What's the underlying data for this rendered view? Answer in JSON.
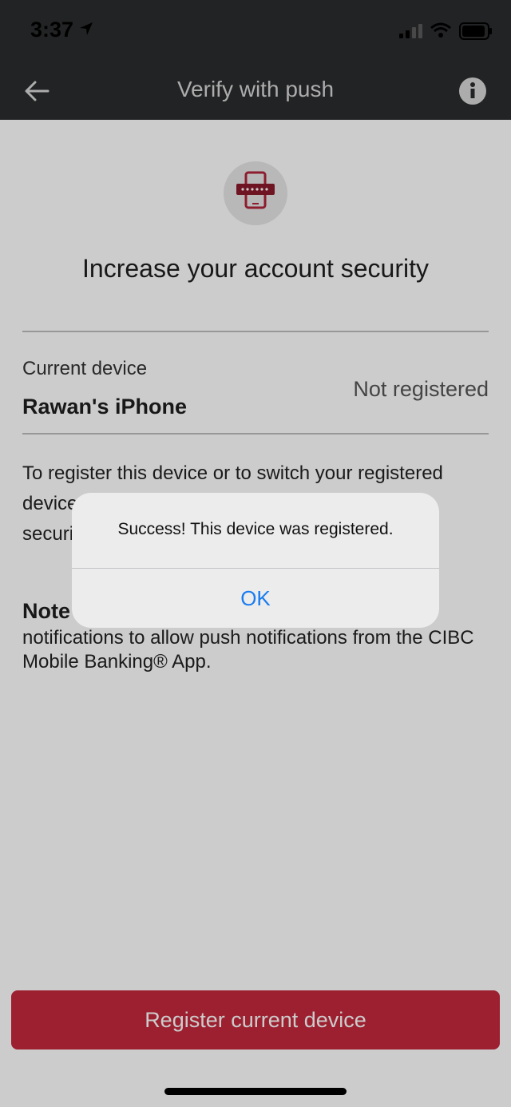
{
  "status_bar": {
    "time": "3:37"
  },
  "nav": {
    "title": "Verify with push"
  },
  "hero": {
    "headline": "Increase your account security"
  },
  "device": {
    "label": "Current device",
    "name": "Rawan's iPhone",
    "status": "Not registered"
  },
  "description": "To register this device or to switch your registered device, select Register current device. For your security, only one device can be registered.",
  "note": {
    "title": "Note",
    "text": "notifications to allow push notifications from the CIBC Mobile Banking® App."
  },
  "register_button": "Register current device",
  "alert": {
    "message": "Success! This device was registered.",
    "ok_label": "OK"
  },
  "colors": {
    "brand_red": "#c4283c",
    "ios_blue": "#1a7cf0",
    "nav_dark": "#2b2c2e"
  }
}
